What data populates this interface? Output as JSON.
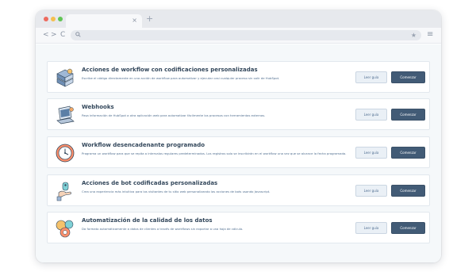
{
  "browser": {
    "tab_close_glyph": "×",
    "new_tab_glyph": "+",
    "nav": {
      "back": "<",
      "forward": ">",
      "reload": "C"
    }
  },
  "cards": [
    {
      "title": "Acciones de workflow con codificaciones personalizadas",
      "description": "Escribe el código directamente en una acción de workflow para automatizar y ejecutar casi cualquier proceso sin salir de HubSpot.",
      "read_label": "Leer guía",
      "start_label": "Comenzar",
      "icon": "server-stack-icon"
    },
    {
      "title": "Webhooks",
      "description": "Pasa información de HubSpot a otra aplicación web para automatizar fácilmente los procesos con herramientas externas.",
      "read_label": "Leer guía",
      "start_label": "Comenzar",
      "icon": "laptop-icon"
    },
    {
      "title": "Workflow desencadenante programado",
      "description": "Programa un workflow para que se repita a intervalos regulares predeterminados. Los registros solo se inscribirán en el workflow una vez que se alcance la fecha programada.",
      "read_label": "Leer guía",
      "start_label": "Comenzar",
      "icon": "clock-icon"
    },
    {
      "title": "Acciones de bot codificadas personalizadas",
      "description": "Crea una experiencia más intuitiva para los visitantes de tu sitio web personalizando las acciones de bots usando Javascript.",
      "read_label": "Leer guía",
      "start_label": "Comenzar",
      "icon": "bot-hand-icon"
    },
    {
      "title": "Automatización de la calidad de los datos",
      "description": "Da formato automáticamente a datos de clientes a través de workflows sin exportar a una hoja de cálculo.",
      "read_label": "Leer guía",
      "start_label": "Comenzar",
      "icon": "data-quality-icon"
    }
  ]
}
